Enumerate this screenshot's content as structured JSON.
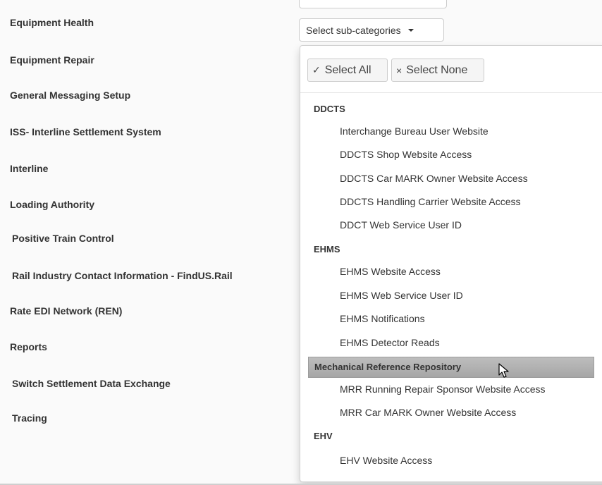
{
  "categories": [
    "Equipment Health",
    "Equipment Repair",
    "General Messaging Setup",
    "ISS- Interline Settlement System",
    "Interline",
    "Loading Authority",
    "Positive Train Control",
    "Rail Industry Contact Information - FindUS.Rail",
    "Rate EDI Network (REN)",
    "Reports",
    "Switch Settlement Data Exchange",
    "Tracing"
  ],
  "select": {
    "label": "Select sub-categories",
    "caret_icon": "caret-down-icon"
  },
  "dropdown": {
    "select_all_label": "Select All",
    "select_all_icon": "✓",
    "select_none_label": "Select None",
    "select_none_icon": "×",
    "groups": [
      {
        "name": "DDCTS",
        "options": [
          "Interchange Bureau User Website",
          "DDCTS Shop Website Access",
          "DDCTS Car MARK Owner Website Access",
          "DDCTS Handling Carrier Website Access",
          "DDCT Web Service User ID"
        ]
      },
      {
        "name": "EHMS",
        "options": [
          "EHMS Website Access",
          "EHMS Web Service User ID",
          "EHMS Notifications",
          "EHMS Detector Reads"
        ]
      },
      {
        "name": "Mechanical Reference Repository",
        "highlighted": true,
        "options": [
          "MRR Running Repair Sponsor Website Access",
          "MRR Car MARK Owner Website Access"
        ]
      },
      {
        "name": "EHV",
        "options": [
          "EHV Website Access"
        ]
      }
    ]
  },
  "colors": {
    "page_bg": "#fafafa",
    "highlight": "#b0b0b0"
  }
}
